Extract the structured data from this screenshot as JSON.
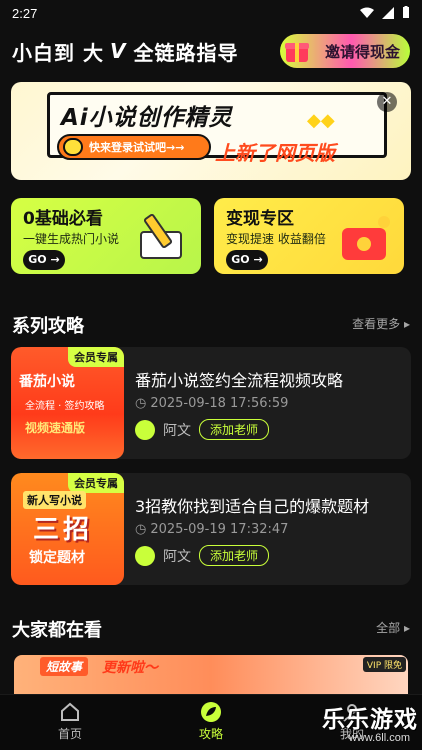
{
  "status_bar": {
    "time": "2:27"
  },
  "header": {
    "title": "小白到 大",
    "vmark": "V",
    "subtitle": "全链路指导",
    "invite_label": "邀请得现金"
  },
  "banner": {
    "title": "Ai小说创作精灵",
    "login_label": "快来登录试试吧→→",
    "new_label": "上新了网页版",
    "close_symbol": "✕"
  },
  "quick_cards": [
    {
      "title": "0基础必看",
      "desc": "一键生成热门小说",
      "go": "GO →"
    },
    {
      "title": "变现专区",
      "desc": "变现提速  收益翻倍",
      "go": "GO →"
    }
  ],
  "guides_section": {
    "title": "系列攻略",
    "more": "查看更多"
  },
  "guides": [
    {
      "badge": "会员专属",
      "thumb_line1": "番茄小说",
      "thumb_line2": "全流程 · 签约攻略",
      "thumb_line3": "视频速通版",
      "title": "番茄小说签约全流程视频攻略",
      "time": "2025-09-18 17:56:59",
      "author": "阿文",
      "button": "添加老师"
    },
    {
      "badge": "会员专属",
      "thumb_line0": "新人写小说",
      "thumb_big": "三招",
      "thumb_line4": "锁定题材",
      "title": "3招教你找到适合自己的爆款题材",
      "time": "2025-09-19 17:32:47",
      "author": "阿文",
      "button": "添加老师"
    }
  ],
  "popular_section": {
    "title": "大家都在看",
    "more": "全部"
  },
  "preview": {
    "tag": "短故事",
    "update": "更新啦～",
    "vip": "VIP 限免"
  },
  "tabs": [
    {
      "label": "首页",
      "icon": "home-icon"
    },
    {
      "label": "攻略",
      "icon": "leaf-icon"
    },
    {
      "label": "我的",
      "icon": "user-icon"
    }
  ],
  "watermark": {
    "line1": "乐乐游戏",
    "line2": "www.6ll.com"
  },
  "colors": {
    "accent": "#c9ff3a",
    "background": "#0f0f0f",
    "card": "#1d1d1d"
  }
}
